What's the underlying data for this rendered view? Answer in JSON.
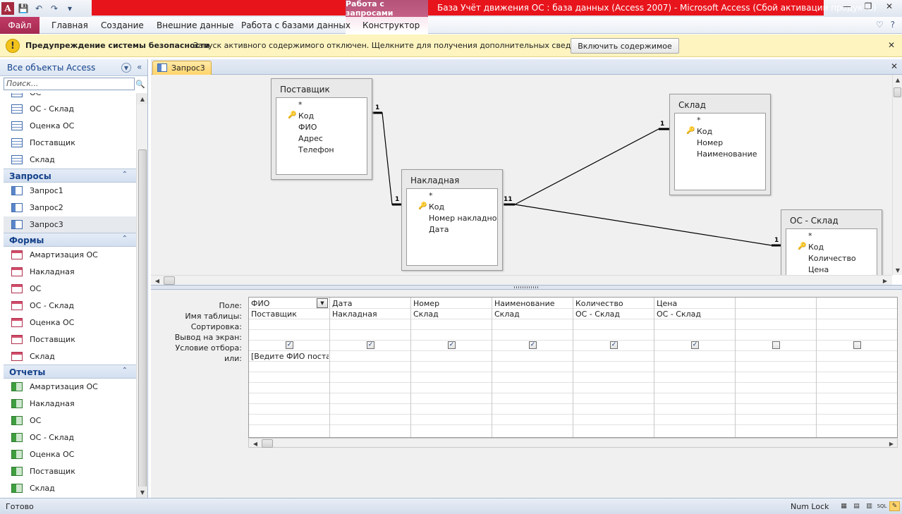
{
  "window": {
    "title": "База Учёт движения ОС : база данных (Access 2007)  -  Microsoft Access (Сбой активации продукта)",
    "context_tab_group": "Работа с запросами",
    "app_icon_letter": "A"
  },
  "ribbon": {
    "file": "Файл",
    "tabs": [
      "Главная",
      "Создание",
      "Внешние данные",
      "Работа с базами данных",
      "Конструктор"
    ]
  },
  "security": {
    "title": "Предупреждение системы безопасности",
    "message": "Запуск активного содержимого отключен. Щелкните для получения дополнительных сведений.",
    "button": "Включить содержимое"
  },
  "nav": {
    "title": "Все объекты Access",
    "search_placeholder": "Поиск...",
    "partial_top": "ОС",
    "tables": [
      "ОС - Склад",
      "Оценка ОС",
      "Поставщик",
      "Склад"
    ],
    "groups": {
      "queries": {
        "label": "Запросы",
        "items": [
          "Запрос1",
          "Запрос2",
          "Запрос3"
        ]
      },
      "forms": {
        "label": "Формы",
        "items": [
          "Амартизация ОС",
          "Накладная",
          "ОС",
          "ОС - Склад",
          "Оценка ОС",
          "Поставщик",
          "Склад"
        ]
      },
      "reports": {
        "label": "Отчеты",
        "items": [
          "Амартизация ОС",
          "Накладная",
          "ОС",
          "ОС - Склад",
          "Оценка ОС",
          "Поставщик",
          "Склад"
        ]
      }
    }
  },
  "document": {
    "tab": "Запрос3"
  },
  "diagram": {
    "tables": [
      {
        "name": "Поставщик",
        "fields": [
          "*",
          "Код",
          "ФИО",
          "Адрес",
          "Телефон"
        ],
        "key": 1
      },
      {
        "name": "Накладная",
        "fields": [
          "*",
          "Код",
          "Номер накладной",
          "Дата"
        ],
        "key": 1
      },
      {
        "name": "Склад",
        "fields": [
          "*",
          "Код",
          "Номер",
          "Наименование"
        ],
        "key": 1
      },
      {
        "name": "ОС - Склад",
        "fields": [
          "*",
          "Код",
          "Количество",
          "Цена"
        ],
        "key": 1
      }
    ],
    "relation_labels": [
      "1",
      "1",
      "1",
      "1",
      "1",
      "1"
    ],
    "many_symbol": "∞"
  },
  "qbe": {
    "row_labels": [
      "Поле:",
      "Имя таблицы:",
      "Сортировка:",
      "Вывод на экран:",
      "Условие отбора:",
      "или:"
    ],
    "columns": [
      {
        "field": "ФИО",
        "table": "Поставщик",
        "show": true,
        "criteria": "[Ведите ФИО поставщика]"
      },
      {
        "field": "Дата",
        "table": "Накладная",
        "show": true,
        "criteria": ""
      },
      {
        "field": "Номер",
        "table": "Склад",
        "show": true,
        "criteria": ""
      },
      {
        "field": "Наименование",
        "table": "Склад",
        "show": true,
        "criteria": ""
      },
      {
        "field": "Количество",
        "table": "ОС - Склад",
        "show": true,
        "criteria": ""
      },
      {
        "field": "Цена",
        "table": "ОС - Склад",
        "show": true,
        "criteria": ""
      },
      {
        "field": "",
        "table": "",
        "show": false,
        "criteria": ""
      },
      {
        "field": "",
        "table": "",
        "show": false,
        "criteria": ""
      }
    ]
  },
  "status": {
    "text": "Готово",
    "numlock": "Num Lock",
    "sql": "SQL"
  }
}
